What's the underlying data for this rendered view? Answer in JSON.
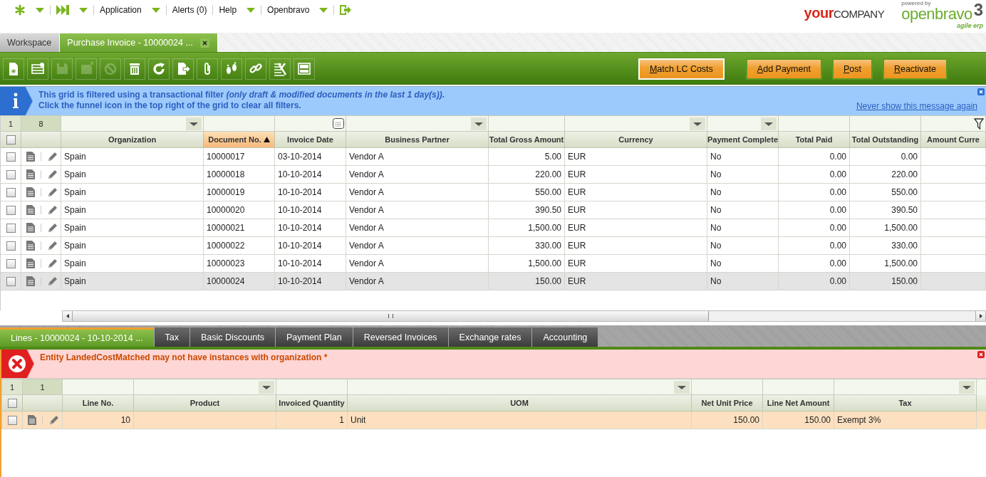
{
  "nav": {
    "items": [
      {
        "kind": "quick-create",
        "caret": true
      },
      {
        "kind": "quick-launch",
        "caret": true
      },
      {
        "kind": "menu",
        "label": "Application",
        "caret": true
      },
      {
        "kind": "link",
        "label": "Alerts (0)",
        "caret": false
      },
      {
        "kind": "menu",
        "label": "Help",
        "caret": true
      },
      {
        "kind": "menu",
        "label": "Openbravo",
        "caret": true
      },
      {
        "kind": "logout",
        "caret": false
      }
    ]
  },
  "logos": {
    "company_first": "your",
    "company_rest": "COMPANY",
    "powered": "powered by",
    "product": "openbravo",
    "version": "3",
    "tagline": "agile erp"
  },
  "tabs": [
    {
      "label": "Workspace",
      "selected": false,
      "closable": false
    },
    {
      "label": "Purchase Invoice - 10000024 ...",
      "selected": true,
      "closable": true
    }
  ],
  "toolbar": {
    "buttons": [
      {
        "kind": "new-document",
        "disabled": false
      },
      {
        "kind": "new-row",
        "disabled": false
      },
      {
        "kind": "save",
        "disabled": true
      },
      {
        "kind": "save-close",
        "disabled": true
      },
      {
        "kind": "undo",
        "disabled": true
      },
      {
        "kind": "delete",
        "disabled": false
      },
      {
        "kind": "refresh",
        "disabled": false
      },
      {
        "kind": "export",
        "disabled": false
      },
      {
        "kind": "attach",
        "disabled": false
      },
      {
        "kind": "audit",
        "disabled": false
      },
      {
        "kind": "link",
        "disabled": false
      },
      {
        "kind": "tools",
        "disabled": false
      },
      {
        "kind": "layout",
        "disabled": false
      }
    ],
    "actions": [
      {
        "label": "Match LC Costs",
        "focused": true
      },
      {
        "label": "Add Payment",
        "focused": false
      },
      {
        "label": "Post",
        "focused": false
      },
      {
        "label": "Reactivate",
        "focused": false
      }
    ]
  },
  "info": {
    "lines": [
      "This grid is filtered using a transactional filter *(only draft & modified documents in the last 1 day(s))*.",
      "Click the funnel icon in the top right of the grid to clear all filters."
    ],
    "link": "Never show this message again"
  },
  "grid": {
    "counts": [
      "1",
      "8"
    ],
    "select_all": false,
    "columns": [
      {
        "label": "Organization",
        "dropdown": true,
        "calendar": false,
        "sorted": false
      },
      {
        "label": "Document No.",
        "dropdown": false,
        "calendar": false,
        "sorted": true
      },
      {
        "label": "Invoice Date",
        "dropdown": false,
        "calendar": true,
        "sorted": false
      },
      {
        "label": "Business Partner",
        "dropdown": true,
        "calendar": false,
        "sorted": false
      },
      {
        "label": "Total Gross Amount",
        "dropdown": false,
        "calendar": false,
        "sorted": false
      },
      {
        "label": "Currency",
        "dropdown": true,
        "calendar": false,
        "sorted": false
      },
      {
        "label": "Payment Complete",
        "dropdown": true,
        "calendar": false,
        "sorted": false
      },
      {
        "label": "Total Paid",
        "dropdown": false,
        "calendar": false,
        "sorted": false
      },
      {
        "label": "Total Outstanding",
        "dropdown": false,
        "calendar": false,
        "sorted": false
      },
      {
        "label": "Amount Curre",
        "dropdown": false,
        "calendar": false,
        "sorted": false
      }
    ],
    "rows": [
      {
        "checked": false,
        "selected": false,
        "cells": [
          "Spain",
          "10000017",
          "03-10-2014",
          "Vendor A",
          "5.00",
          "EUR",
          "No",
          "0.00",
          "0.00"
        ]
      },
      {
        "checked": false,
        "selected": false,
        "cells": [
          "Spain",
          "10000018",
          "10-10-2014",
          "Vendor A",
          "220.00",
          "EUR",
          "No",
          "0.00",
          "220.00"
        ]
      },
      {
        "checked": false,
        "selected": false,
        "cells": [
          "Spain",
          "10000019",
          "10-10-2014",
          "Vendor A",
          "550.00",
          "EUR",
          "No",
          "0.00",
          "550.00"
        ]
      },
      {
        "checked": false,
        "selected": false,
        "cells": [
          "Spain",
          "10000020",
          "10-10-2014",
          "Vendor A",
          "390.50",
          "EUR",
          "No",
          "0.00",
          "390.50"
        ]
      },
      {
        "checked": false,
        "selected": false,
        "cells": [
          "Spain",
          "10000021",
          "10-10-2014",
          "Vendor A",
          "1,500.00",
          "EUR",
          "No",
          "0.00",
          "1,500.00"
        ]
      },
      {
        "checked": false,
        "selected": false,
        "cells": [
          "Spain",
          "10000022",
          "10-10-2014",
          "Vendor A",
          "330.00",
          "EUR",
          "No",
          "0.00",
          "330.00"
        ]
      },
      {
        "checked": false,
        "selected": false,
        "cells": [
          "Spain",
          "10000023",
          "10-10-2014",
          "Vendor A",
          "1,500.00",
          "EUR",
          "No",
          "0.00",
          "1,500.00"
        ]
      },
      {
        "checked": false,
        "selected": true,
        "cells": [
          "Spain",
          "10000024",
          "10-10-2014",
          "Vendor A",
          "150.00",
          "EUR",
          "No",
          "0.00",
          "150.00"
        ]
      }
    ]
  },
  "subtabs": [
    {
      "label": "Lines - 10000024 - 10-10-2014 ...",
      "selected": true
    },
    {
      "label": "Tax",
      "selected": false
    },
    {
      "label": "Basic Discounts",
      "selected": false
    },
    {
      "label": "Payment Plan",
      "selected": false
    },
    {
      "label": "Reversed Invoices",
      "selected": false
    },
    {
      "label": "Exchange rates",
      "selected": false
    },
    {
      "label": "Accounting",
      "selected": false
    }
  ],
  "error": {
    "text": "Entity LandedCostMatched may not have instances with organization *"
  },
  "lines_grid": {
    "counts": [
      "1",
      "1"
    ],
    "select_all": false,
    "columns": [
      {
        "label": "Line No.",
        "dropdown": false,
        "calendar": false,
        "sorted": false
      },
      {
        "label": "Product",
        "dropdown": true,
        "calendar": false,
        "sorted": false
      },
      {
        "label": "Invoiced Quantity",
        "dropdown": false,
        "calendar": false,
        "sorted": false
      },
      {
        "label": "UOM",
        "dropdown": true,
        "calendar": false,
        "sorted": false
      },
      {
        "label": "Net Unit Price",
        "dropdown": false,
        "calendar": false,
        "sorted": false
      },
      {
        "label": "Line Net Amount",
        "dropdown": false,
        "calendar": false,
        "sorted": false
      },
      {
        "label": "Tax",
        "dropdown": true,
        "calendar": false,
        "sorted": false
      }
    ],
    "rows": [
      {
        "checked": false,
        "selected": true,
        "cells": [
          "10",
          "",
          "1",
          "Unit",
          "150.00",
          "150.00",
          "Exempt 3%"
        ]
      }
    ]
  }
}
